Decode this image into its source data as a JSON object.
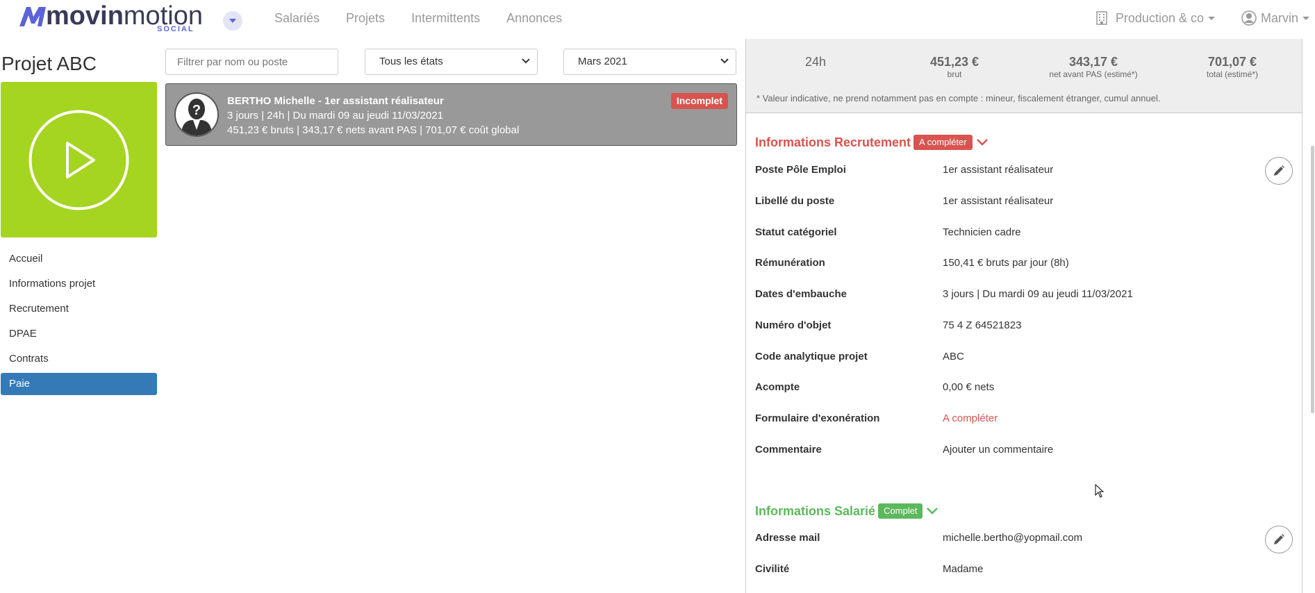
{
  "header": {
    "logo_text_a": "movin",
    "logo_text_b": "motion",
    "logo_sub": "SOCIAL",
    "nav": [
      {
        "label": "Salariés"
      },
      {
        "label": "Projets"
      },
      {
        "label": "Intermittents"
      },
      {
        "label": "Annonces"
      }
    ],
    "company": "Production & co",
    "user": "Marvin"
  },
  "project": {
    "title": "Projet ABC",
    "tile_color": "#a5d421",
    "menu": [
      {
        "label": "Accueil",
        "active": false
      },
      {
        "label": "Informations projet",
        "active": false
      },
      {
        "label": "Recrutement",
        "active": false
      },
      {
        "label": "DPAE",
        "active": false
      },
      {
        "label": "Contrats",
        "active": false
      },
      {
        "label": "Paie",
        "active": true
      }
    ]
  },
  "filters": {
    "search_placeholder": "Filtrer par nom ou poste",
    "state_selected": "Tous les états",
    "month_selected": "Mars 2021"
  },
  "employee": {
    "name_line": "BERTHO Michelle - 1er assistant réalisateur",
    "line2": "3 jours | 24h | Du mardi 09 au jeudi 11/03/2021",
    "line3": "451,23 € bruts | 343,17 € nets avant PAS | 701,07 € coût global",
    "badge": "Incomplet"
  },
  "summary": {
    "hours": "24h",
    "brut": "451,23 €",
    "brut_label": "brut",
    "net": "343,17 €",
    "net_label": "net avant PAS (estimé*)",
    "total": "701,07 €",
    "total_label": "total (estimé*)",
    "note": "* Valeur indicative, ne prend notamment pas en compte : mineur, fiscalement étranger, cumul annuel."
  },
  "recrutement": {
    "title": "Informations Recrutement",
    "badge": "A compléter",
    "rows": [
      {
        "label": "Poste Pôle Emploi",
        "value": "1er assistant réalisateur"
      },
      {
        "label": "Libellé du poste",
        "value": "1er assistant réalisateur"
      },
      {
        "label": "Statut catégoriel",
        "value": "Technicien cadre"
      },
      {
        "label": "Rémunération",
        "value": "150,41 € bruts par jour (8h)"
      },
      {
        "label": "Dates d'embauche",
        "value": "3 jours | Du mardi 09 au jeudi 11/03/2021"
      },
      {
        "label": "Numéro d'objet",
        "value": "75 4 Z 64521823"
      },
      {
        "label": "Code analytique projet",
        "value": "ABC"
      },
      {
        "label": "Acompte",
        "value": "0,00 € nets"
      },
      {
        "label": "Formulaire d'exonération",
        "value": "A compléter"
      },
      {
        "label": "Commentaire",
        "value": "Ajouter un commentaire"
      }
    ]
  },
  "salarie": {
    "title": "Informations Salarié",
    "badge": "Complet",
    "rows": [
      {
        "label": "Adresse mail",
        "value": "michelle.bertho@yopmail.com"
      },
      {
        "label": "Civilité",
        "value": "Madame"
      }
    ]
  },
  "colors": {
    "accent_blue": "#337ab7",
    "danger": "#d9534f",
    "success": "#5cb85c",
    "brand": "#5b63d8"
  }
}
